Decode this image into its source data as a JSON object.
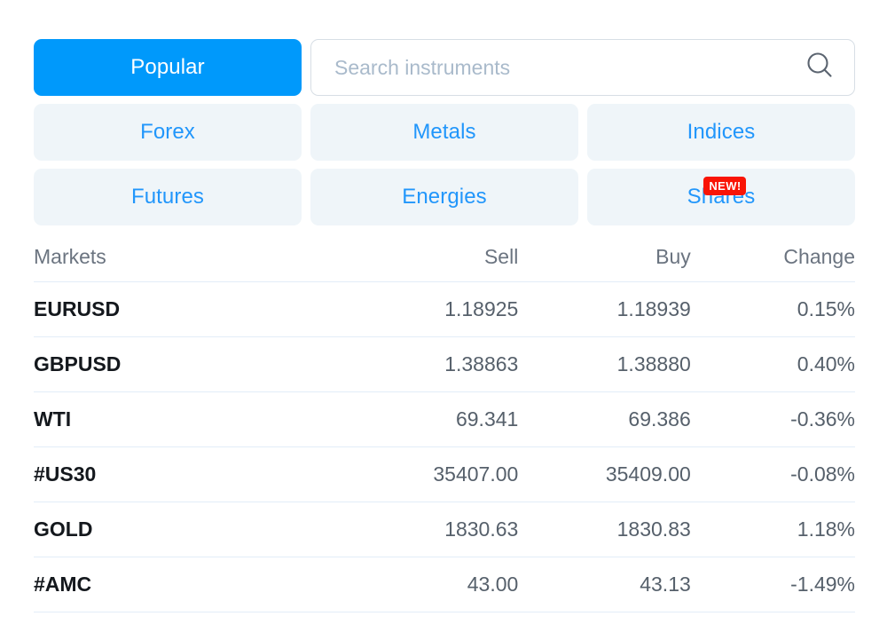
{
  "tabs": [
    {
      "id": "popular",
      "label": "Popular",
      "active": true,
      "badge": null
    },
    {
      "id": "forex",
      "label": "Forex",
      "active": false,
      "badge": null
    },
    {
      "id": "metals",
      "label": "Metals",
      "active": false,
      "badge": null
    },
    {
      "id": "indices",
      "label": "Indices",
      "active": false,
      "badge": null
    },
    {
      "id": "futures",
      "label": "Futures",
      "active": false,
      "badge": null
    },
    {
      "id": "energies",
      "label": "Energies",
      "active": false,
      "badge": null
    },
    {
      "id": "shares",
      "label": "Shares",
      "active": false,
      "badge": "NEW!"
    }
  ],
  "search": {
    "placeholder": "Search instruments",
    "value": "",
    "icon": "search-icon"
  },
  "table": {
    "headers": {
      "market": "Markets",
      "sell": "Sell",
      "buy": "Buy",
      "change": "Change"
    },
    "rows": [
      {
        "market": "EURUSD",
        "sell": "1.18925",
        "buy": "1.18939",
        "change": "0.15%"
      },
      {
        "market": "GBPUSD",
        "sell": "1.38863",
        "buy": "1.38880",
        "change": "0.40%"
      },
      {
        "market": "WTI",
        "sell": "69.341",
        "buy": "69.386",
        "change": "-0.36%"
      },
      {
        "market": "#US30",
        "sell": "35407.00",
        "buy": "35409.00",
        "change": "-0.08%"
      },
      {
        "market": "GOLD",
        "sell": "1830.63",
        "buy": "1830.83",
        "change": "1.18%"
      },
      {
        "market": "#AMC",
        "sell": "43.00",
        "buy": "43.13",
        "change": "-1.49%"
      }
    ]
  },
  "colors": {
    "accent": "#0099fb",
    "tab_text": "#2196fb",
    "tab_bg": "#eff5f9",
    "badge_bg": "#f91405",
    "divider": "#e2edf8",
    "symbol_text": "#14181d",
    "value_text": "#56606b",
    "header_text": "#6b7480",
    "placeholder": "#a9bacb"
  }
}
